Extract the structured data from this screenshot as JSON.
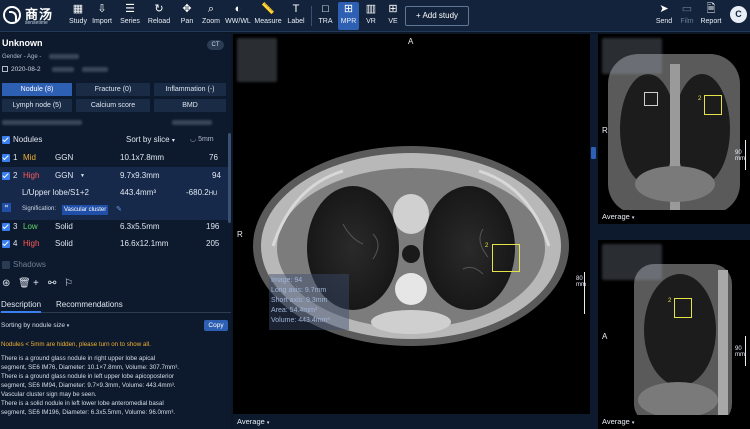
{
  "app": {
    "logo_text": "商汤",
    "logo_sub": "sensetime"
  },
  "toolbar": {
    "tools": [
      {
        "key": "study",
        "label": "Study",
        "icon": "▦"
      },
      {
        "key": "import",
        "label": "Import",
        "icon": "⇩"
      },
      {
        "key": "series",
        "label": "Series",
        "icon": "☰"
      },
      {
        "key": "reload",
        "label": "Reload",
        "icon": "↻"
      },
      {
        "key": "pan",
        "label": "Pan",
        "icon": "✥"
      },
      {
        "key": "zoom",
        "label": "Zoom",
        "icon": "⌕"
      },
      {
        "key": "wwwl",
        "label": "WW/WL",
        "icon": "◐"
      },
      {
        "key": "measure",
        "label": "Measure",
        "icon": "📏"
      },
      {
        "key": "label",
        "label": "Label",
        "icon": "T"
      },
      {
        "key": "tra",
        "label": "TRA",
        "icon": "□"
      },
      {
        "key": "mpr",
        "label": "MPR",
        "icon": "⊞"
      },
      {
        "key": "vr",
        "label": "VR",
        "icon": "▥"
      },
      {
        "key": "ve",
        "label": "VE",
        "icon": "⊞"
      }
    ],
    "add_study": "+ Add study",
    "right_tools": [
      {
        "key": "send",
        "label": "Send",
        "icon": "➤"
      },
      {
        "key": "film",
        "label": "Film",
        "icon": "▭"
      },
      {
        "key": "report",
        "label": "Report",
        "icon": "🗎"
      }
    ],
    "avatar": "C"
  },
  "patient": {
    "name": "Unknown",
    "modality": "CT",
    "gender_age": "Gender - Age -",
    "date": "2020-08-2"
  },
  "tabs": [
    {
      "label": "Nodule (8)",
      "active": true
    },
    {
      "label": "Fracture (0)",
      "active": false
    },
    {
      "label": "Inflammation (-)",
      "active": false
    },
    {
      "label": "Lymph node (5)",
      "active": false
    },
    {
      "label": "Calcium score",
      "active": false
    },
    {
      "label": "BMD",
      "active": false
    }
  ],
  "nodule_list": {
    "header": "Nodules",
    "sort": "Sort by slice",
    "size_filter": "5mm",
    "rows": [
      {
        "index": "1",
        "risk": "Mid",
        "risk_class": "mid",
        "type": "GGN",
        "size": "10.1x7.8mm",
        "slice": "76"
      },
      {
        "index": "2",
        "risk": "High",
        "risk_class": "high",
        "type": "GGN",
        "size": "9.7x9.3mm",
        "slice": "94"
      },
      {
        "index": "3",
        "risk": "Low",
        "risk_class": "low",
        "type": "Solid",
        "size": "6.3x5.5mm",
        "slice": "196"
      },
      {
        "index": "4",
        "risk": "High",
        "risk_class": "high",
        "type": "Solid",
        "size": "16.6x12.1mm",
        "slice": "205"
      }
    ],
    "detail": {
      "location": "L/Upper lobe/S1+2",
      "volume": "443.4mm³",
      "hu": "-680.2",
      "hu_unit": "HU",
      "signification_label": "Signification:",
      "signification_tag": "Vascular cluster"
    },
    "shadows": "Shadows"
  },
  "description": {
    "tabs": [
      "Description",
      "Recommendations"
    ],
    "sort": "Sorting by nodule size",
    "copy": "Copy",
    "warning": "Nodules < 5mm are hidden, please turn on to show all.",
    "lines": [
      "There is a ground glass nodule in  right upper lobe apical",
      "segment, SE6 IM76, Diameter: 10.1×7.8mm, Volume: 307.7mm³.",
      "There is a ground glass nodule in  left upper lobe apicoposterior",
      "segment, SE6 IM94, Diameter: 9.7×9.3mm, Volume: 443.4mm³.",
      "Vascular cluster sign may be seen.",
      "There is a solid nodule in  left lower lobe anteromedial basal",
      "segment, SE6 IM196, Diameter: 6.3x5.5mm, Volume: 96.0mm³."
    ]
  },
  "viewer": {
    "main": {
      "orient_top": "A",
      "orient_left": "R",
      "footer": "Average",
      "scale": "80 mm",
      "marker": "2",
      "measure": [
        "Image: 94",
        "Long axis: 9.7mm",
        "Short axis: 9.3mm",
        "Area: 54.4mm²",
        "Volume: 443.4mm³"
      ]
    },
    "coronal": {
      "orient_left": "R",
      "footer": "Average",
      "scale": "90 mm",
      "marker": "2"
    },
    "sagittal": {
      "orient_left": "A",
      "footer": "Average",
      "scale": "90 mm",
      "marker": "2"
    }
  }
}
